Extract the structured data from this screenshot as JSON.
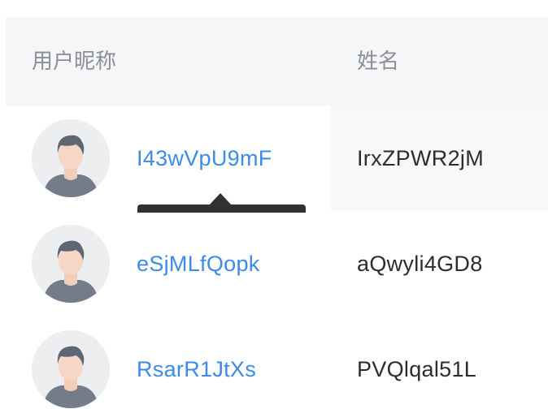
{
  "table": {
    "columns": {
      "nickname": "用户昵称",
      "name": "姓名"
    },
    "rows": [
      {
        "nickname": "I43wVpU9mF",
        "name": "IrxZPWR2jM",
        "avatar_icon": "user-avatar-icon"
      },
      {
        "nickname": "eSjMLfQopk",
        "name": "aQwyli4GD8",
        "avatar_icon": "user-avatar-icon"
      },
      {
        "nickname": "RsarR1JtXs",
        "name": "PVQlqal51L",
        "avatar_icon": "user-avatar-icon"
      }
    ]
  },
  "colors": {
    "link": "#3b8bea",
    "header_bg": "#f5f6f7",
    "tooltip_bg": "#303133"
  }
}
